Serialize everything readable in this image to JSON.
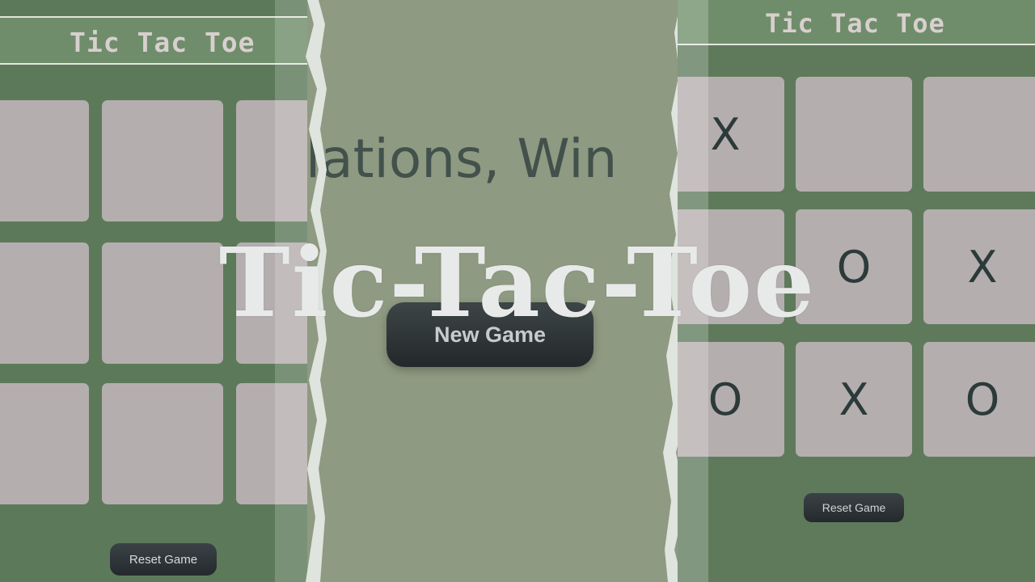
{
  "left_screen": {
    "title": "Tic Tac Toe",
    "reset_label": "Reset Game",
    "cells": [
      "",
      "",
      "",
      "",
      "",
      "",
      "",
      "",
      ""
    ]
  },
  "middle_screen": {
    "message": "ulations, Win",
    "new_game_label": "New Game"
  },
  "right_screen": {
    "title": "Tic Tac Toe",
    "reset_label": "Reset Game",
    "cells": [
      "X",
      "",
      "",
      "",
      "O",
      "X",
      "O",
      "X",
      "O"
    ]
  },
  "overlay": {
    "title": "Tic-Tac-Toe"
  },
  "colors": {
    "board_background": "#5c7a5a",
    "cell": "#b5aeae",
    "mark": "#2c3a3a",
    "middle_background": "#8e9a81",
    "button": "#2e3538",
    "overlay_text": "#e8eaea"
  }
}
